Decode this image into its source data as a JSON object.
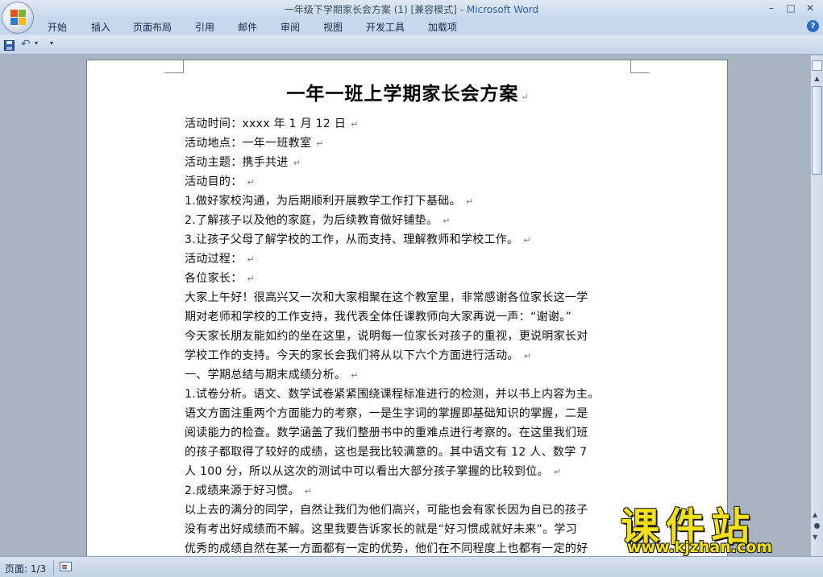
{
  "window": {
    "title_doc": "一年级下学期家长会方案 (1) [兼容模式] - ",
    "title_app": "Microsoft Word",
    "minimize": "–",
    "maximize": "□",
    "close": "✕"
  },
  "ribbon": {
    "tabs": [
      "开始",
      "插入",
      "页面布局",
      "引用",
      "邮件",
      "审阅",
      "视图",
      "开发工具",
      "加载项"
    ],
    "help": "?"
  },
  "qat": {
    "undo_glyph": "↶",
    "dropdown_glyph": "▾",
    "customize_glyph": "▾"
  },
  "document": {
    "title": "一年一班上学期家长会方案",
    "paragraph_mark": "↵",
    "lines": [
      "活动时间：xxxx 年 1 月 12 日",
      "活动地点：一年一班教室",
      "活动主题：携手共进",
      "活动目的：",
      "1.做好家校沟通，为后期顺利开展教学工作打下基础。",
      "2.了解孩子以及他的家庭，为后续教育做好铺垫。",
      "3.让孩子父母了解学校的工作，从而支持、理解教师和学校工作。",
      "活动过程：",
      "各位家长：",
      "大家上午好！很高兴又一次和大家相聚在这个教室里，非常感谢各位家长这一学",
      "期对老师和学校的工作支持，我代表全体任课教师向大家再说一声：“谢谢。”",
      "今天家长朋友能如约的坐在这里，说明每一位家长对孩子的重视，更说明家长对",
      "学校工作的支持。今天的家长会我们将从以下六个方面进行活动。",
      "一、学期总结与期末成绩分析。",
      "1.试卷分析。语文、数学试卷紧紧围绕课程标准进行的检测，并以书上内容为主。",
      "语文方面注重两个方面能力的考察，一是生字词的掌握即基础知识的掌握，二是",
      "阅读能力的检查。数学涵盖了我们整册书中的重难点进行考察的。在这里我们班",
      "的孩子都取得了较好的成绩，这也是我比较满意的。其中语文有 12 人、数学 7",
      "人 100 分，所以从这次的测试中可以看出大部分孩子掌握的比较到位。",
      "2.成绩来源于好习惯。",
      "以上去的满分的同学，自然让我们为他们高兴，可能也会有家长因为自已的孩子",
      "没有考出好成绩而不解。这里我要告诉家长的就是“好习惯成就好未来”。学习",
      "优秀的成绩自然在某一方面都有一定的优势，他们在不同程度上也都有一定的好"
    ],
    "lines_with_mark": [
      true,
      true,
      true,
      true,
      true,
      true,
      true,
      true,
      true,
      false,
      false,
      false,
      true,
      true,
      false,
      false,
      false,
      false,
      true,
      true,
      false,
      false,
      false
    ]
  },
  "scrollbar": {
    "up": "▲",
    "prev": "▲",
    "next": "▼"
  },
  "status": {
    "page": "页面: 1/3"
  },
  "watermark": {
    "text": "课件站",
    "url": "www.kjzhan.com"
  }
}
